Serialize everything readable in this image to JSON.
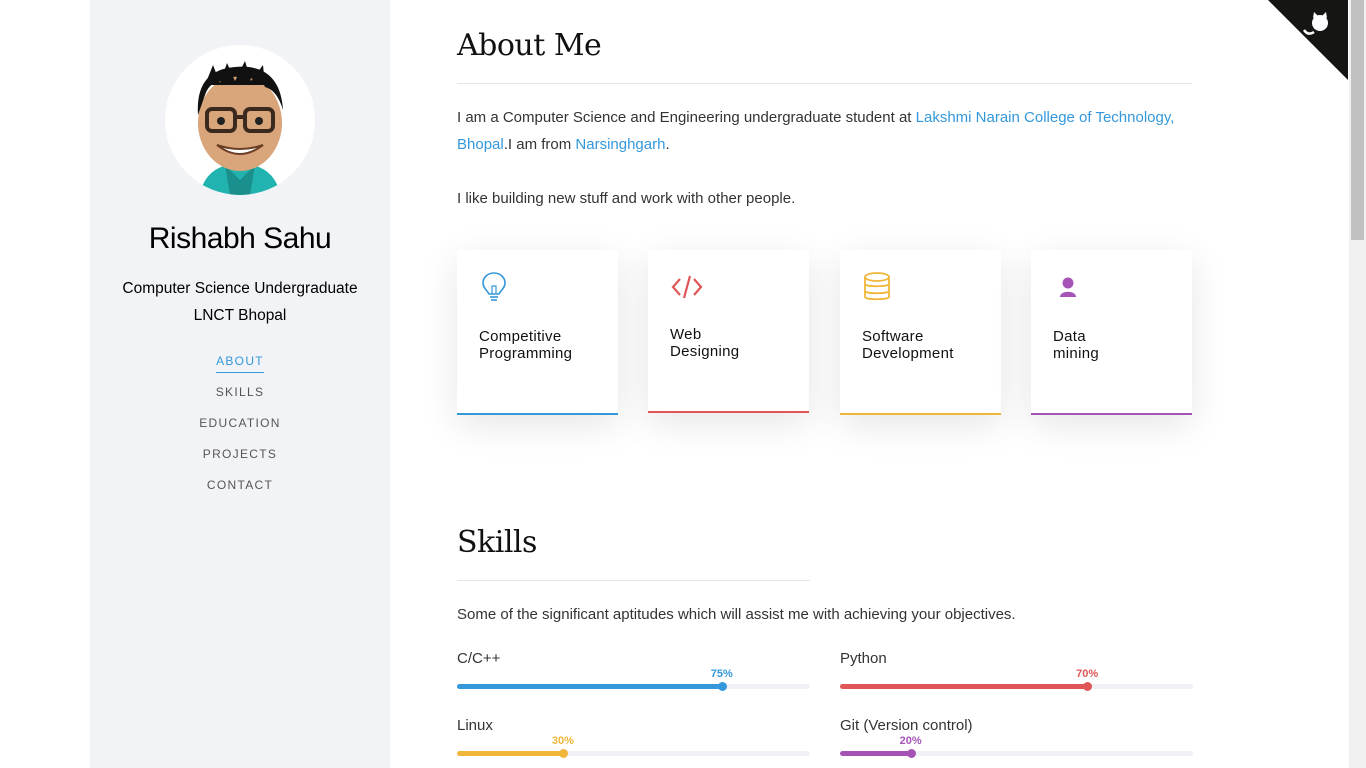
{
  "sidebar": {
    "name": "Rishabh Sahu",
    "subtitle_line1": "Computer Science Undergraduate",
    "subtitle_line2": "LNCT Bhopal",
    "nav": [
      "ABOUT",
      "SKILLS",
      "EDUCATION",
      "PROJECTS",
      "CONTACT"
    ],
    "active_nav": "ABOUT"
  },
  "about": {
    "heading": "About Me",
    "p1_start": "I am a Computer Science and Engineering undergraduate student at ",
    "p1_link1": "Lakshmi Narain College of Technology, Bhopal",
    "p1_mid": ".I am from ",
    "p1_link2": "Narsinghgarh",
    "p1_end": ".",
    "p2": "I like building new stuff and work with other people."
  },
  "cards": [
    {
      "label": "Competitive\nProgramming",
      "icon": "lightbulb-icon",
      "color": "#3498db"
    },
    {
      "label": "Web\nDesigning",
      "icon": "code-icon",
      "color": "#e05555"
    },
    {
      "label": "Software\nDevelopment",
      "icon": "database-icon",
      "color": "#f0b63a"
    },
    {
      "label": "Data\nmining",
      "icon": "user-icon",
      "color": "#a554b6"
    }
  ],
  "skills": {
    "heading": "Skills",
    "intro": "Some of the significant aptitudes which will assist me with achieving your objectives.",
    "items": [
      {
        "name": "C/C++",
        "percent_label": "75%",
        "level": 0.75,
        "color": "#3498db"
      },
      {
        "name": "Python",
        "percent_label": "70%",
        "level": 0.7,
        "color": "#e05555"
      },
      {
        "name": "Linux",
        "percent_label": "30%",
        "level": 0.3,
        "color": "#f0b63a"
      },
      {
        "name": "Git (Version control)",
        "percent_label": "20%",
        "level": 0.2,
        "color": "#a554b6"
      }
    ]
  },
  "corner_icon": "github-octocat-icon"
}
